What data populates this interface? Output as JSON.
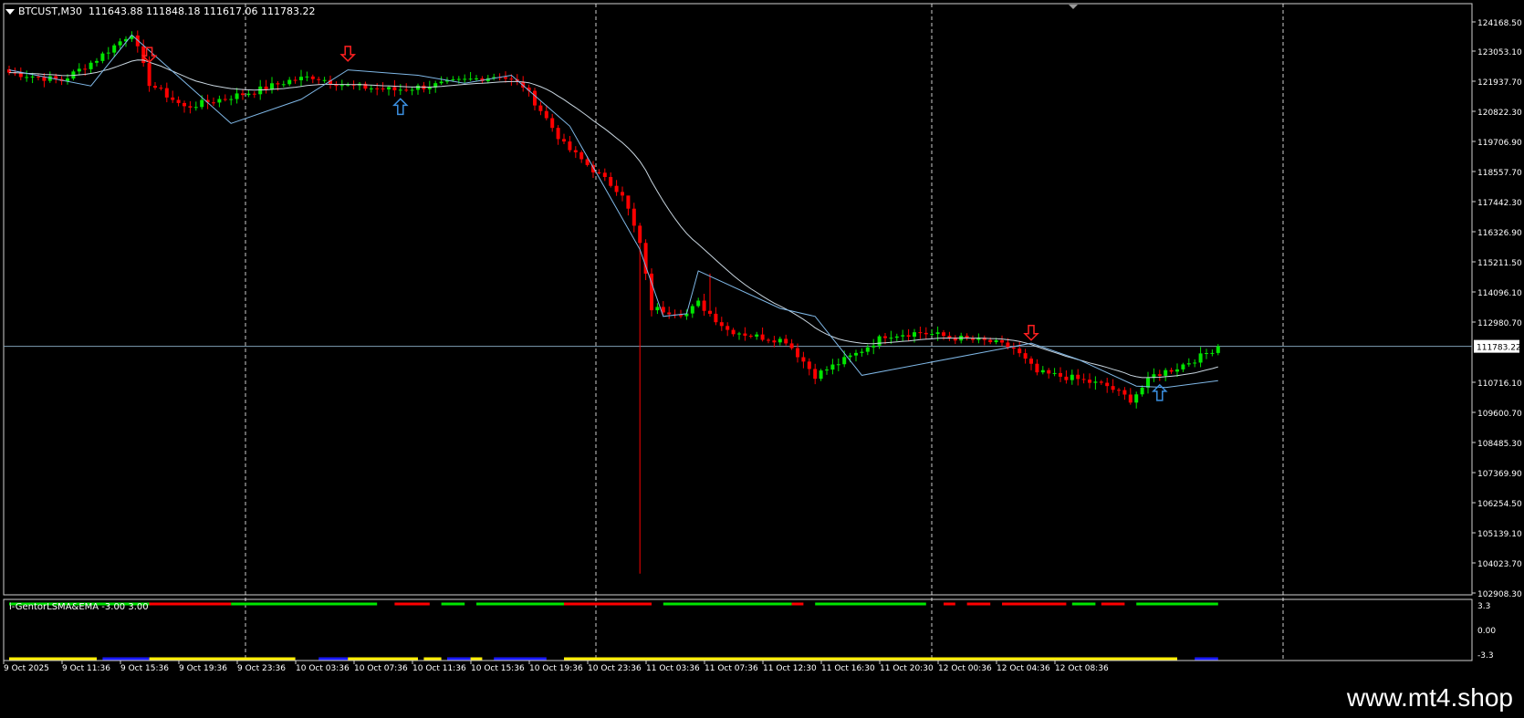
{
  "header": {
    "symbol": "BTCUST,M30",
    "ohlc": "111643.88 111848.18 111617.06 111783.22"
  },
  "indicator": {
    "label": "i-GentorLSMA&EMA -3.00 3.00",
    "ticks": [
      "3.3",
      "0.00",
      "-3.3"
    ]
  },
  "watermark": "www.mt4.shop",
  "colors": {
    "background": "#000000",
    "bull": "#00e600",
    "bear": "#ff0000",
    "ma_fast": "#7fb7e6",
    "ma_slow": "#c9d6e0",
    "current_line": "#7f9fb5",
    "grid": "#ffffff",
    "ind_yellow": "#ffee00",
    "ind_blue": "#1a1aff",
    "up_arrow": "#3b8fe0",
    "down_arrow": "#ff2020"
  },
  "chart_data": {
    "type": "candlestick",
    "current_price": "111783.22",
    "y_ticks": [
      "124168.50",
      "123053.10",
      "121937.70",
      "120822.30",
      "119706.90",
      "118557.70",
      "117442.30",
      "116326.90",
      "115211.50",
      "114096.10",
      "112980.70",
      "110716.10",
      "109600.70",
      "108485.30",
      "107369.90",
      "106254.50",
      "105139.10",
      "104023.70",
      "102908.30"
    ],
    "x_ticks": [
      "9 Oct 2025",
      "9 Oct 11:36",
      "9 Oct 15:36",
      "9 Oct 19:36",
      "9 Oct 23:36",
      "10 Oct 03:36",
      "10 Oct 07:36",
      "10 Oct 11:36",
      "10 Oct 15:36",
      "10 Oct 19:36",
      "10 Oct 23:36",
      "11 Oct 03:36",
      "11 Oct 07:36",
      "11 Oct 12:30",
      "11 Oct 16:30",
      "11 Oct 20:30",
      "12 Oct 00:36",
      "12 Oct 04:36",
      "12 Oct 08:36"
    ],
    "anchors": [
      [
        0,
        122000
      ],
      [
        9,
        121700
      ],
      [
        15,
        122500
      ],
      [
        21,
        123500
      ],
      [
        24,
        121600
      ],
      [
        30,
        120700
      ],
      [
        36,
        121000
      ],
      [
        42,
        121300
      ],
      [
        48,
        121700
      ],
      [
        52,
        121850
      ],
      [
        58,
        121500
      ],
      [
        66,
        121350
      ],
      [
        72,
        121500
      ],
      [
        78,
        121700
      ],
      [
        84,
        121900
      ],
      [
        88,
        121500
      ],
      [
        91,
        120600
      ],
      [
        95,
        119300
      ],
      [
        102,
        118000
      ],
      [
        105,
        117500
      ],
      [
        108,
        115600
      ],
      [
        110,
        113200
      ],
      [
        116,
        113000
      ],
      [
        118,
        113400
      ],
      [
        123,
        112400
      ],
      [
        128,
        112150
      ],
      [
        133,
        112000
      ],
      [
        138,
        110700
      ],
      [
        145,
        111500
      ],
      [
        150,
        112200
      ],
      [
        156,
        112300
      ],
      [
        162,
        112100
      ],
      [
        168,
        111950
      ],
      [
        172,
        111700
      ],
      [
        176,
        110800
      ],
      [
        182,
        110600
      ],
      [
        188,
        110300
      ],
      [
        192,
        109800
      ],
      [
        196,
        110700
      ],
      [
        200,
        111000
      ],
      [
        204,
        111400
      ],
      [
        207,
        111783.22
      ]
    ],
    "ind_top": [
      {
        "from": 0,
        "to": 24,
        "color": "green"
      },
      {
        "from": 24,
        "to": 38,
        "color": "red"
      },
      {
        "from": 38,
        "to": 60,
        "color": "green"
      },
      {
        "from": 60,
        "to": 63,
        "color": "green"
      },
      {
        "from": 66,
        "to": 72,
        "color": "red"
      },
      {
        "from": 74,
        "to": 78,
        "color": "green"
      },
      {
        "from": 80,
        "to": 95,
        "color": "green"
      },
      {
        "from": 95,
        "to": 110,
        "color": "red"
      },
      {
        "from": 112,
        "to": 134,
        "color": "green"
      },
      {
        "from": 134,
        "to": 136,
        "color": "red"
      },
      {
        "from": 138,
        "to": 157,
        "color": "green"
      },
      {
        "from": 160,
        "to": 162,
        "color": "red"
      },
      {
        "from": 164,
        "to": 168,
        "color": "red"
      },
      {
        "from": 170,
        "to": 181,
        "color": "red"
      },
      {
        "from": 182,
        "to": 186,
        "color": "green"
      },
      {
        "from": 187,
        "to": 191,
        "color": "red"
      },
      {
        "from": 193,
        "to": 207,
        "color": "green"
      }
    ],
    "ind_bottom": [
      {
        "from": 0,
        "to": 15,
        "color": "yellow"
      },
      {
        "from": 16,
        "to": 24,
        "color": "blue"
      },
      {
        "from": 24,
        "to": 49,
        "color": "yellow"
      },
      {
        "from": 53,
        "to": 58,
        "color": "blue"
      },
      {
        "from": 58,
        "to": 70,
        "color": "yellow"
      },
      {
        "from": 71,
        "to": 74,
        "color": "yellow"
      },
      {
        "from": 75,
        "to": 79,
        "color": "blue"
      },
      {
        "from": 79,
        "to": 81,
        "color": "yellow"
      },
      {
        "from": 83,
        "to": 92,
        "color": "blue"
      },
      {
        "from": 95,
        "to": 200,
        "color": "yellow"
      },
      {
        "from": 203,
        "to": 207,
        "color": "blue"
      }
    ],
    "signals": [
      {
        "type": "down",
        "index": 24
      },
      {
        "type": "down",
        "index": 58
      },
      {
        "type": "up",
        "index": 67
      },
      {
        "type": "down",
        "index": 175
      },
      {
        "type": "up",
        "index": 197
      }
    ]
  }
}
